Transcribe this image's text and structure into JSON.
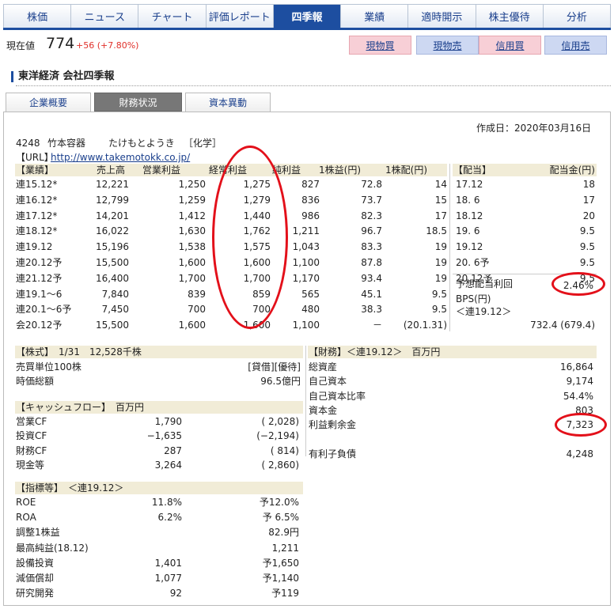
{
  "nav": {
    "tabs": [
      "株価",
      "ニュース",
      "チャート",
      "評価レポート",
      "四季報",
      "業績",
      "適時開示",
      "株主優待",
      "分析"
    ],
    "active_index": 4
  },
  "price": {
    "label": "現在値",
    "value": "774",
    "change": "+56 (+7.80%)"
  },
  "trade_buttons": [
    "現物買",
    "現物売",
    "信用買",
    "信用売"
  ],
  "section_title": "東洋経済 会社四季報",
  "subtabs": [
    "企業概要",
    "財務状況",
    "資本異動"
  ],
  "created": "作成日：2020年03月16日",
  "company": {
    "code": "4248",
    "name": "竹本容器",
    "kana": "たけもとようき",
    "industry": "［化学］",
    "url_label": "【URL】",
    "url": "http://www.takemotokk.co.jp/"
  },
  "results": {
    "headers": [
      "【業績】",
      "売上高",
      "営業利益",
      "経常利益",
      "純利益",
      "1株益(円)",
      "1株配(円)"
    ],
    "rows": [
      [
        "連15.12*",
        "12,221",
        "1,250",
        "1,275",
        "827",
        "72.8",
        "14"
      ],
      [
        "連16.12*",
        "12,799",
        "1,259",
        "1,279",
        "836",
        "73.7",
        "15"
      ],
      [
        "連17.12*",
        "14,201",
        "1,412",
        "1,440",
        "986",
        "82.3",
        "17"
      ],
      [
        "連18.12*",
        "16,022",
        "1,630",
        "1,762",
        "1,211",
        "96.7",
        "18.5"
      ],
      [
        "連19.12",
        "15,196",
        "1,538",
        "1,575",
        "1,043",
        "83.3",
        "19"
      ],
      [
        "連20.12予",
        "15,500",
        "1,600",
        "1,600",
        "1,100",
        "87.8",
        "19"
      ],
      [
        "連21.12予",
        "16,400",
        "1,700",
        "1,700",
        "1,170",
        "93.4",
        "19"
      ],
      [
        "連19.1～6",
        "7,840",
        "839",
        "859",
        "565",
        "45.1",
        "9.5"
      ],
      [
        "連20.1～6予",
        "7,450",
        "700",
        "700",
        "480",
        "38.3",
        "9.5"
      ],
      [
        "会20.12予",
        "15,500",
        "1,600",
        "1,600",
        "1,100",
        "－",
        "(20.1.31)"
      ]
    ]
  },
  "dividend": {
    "headers": [
      "【配当】",
      "配当金(円)"
    ],
    "rows": [
      [
        "17.12",
        "18"
      ],
      [
        "18. 6",
        "17"
      ],
      [
        "18.12",
        "20"
      ],
      [
        "19. 6",
        "9.5"
      ],
      [
        "19.12",
        "9.5"
      ],
      [
        "20. 6予",
        "9.5"
      ],
      [
        "20.12予",
        "9.5"
      ]
    ],
    "yield_label": "予想配当利回",
    "yield_value": "2.46%",
    "bps_label": "BPS(円)",
    "bps_basis": "＜連19.12＞",
    "bps_value": "732.4 (679.4)"
  },
  "stock": {
    "header": "【株式】　1/31　12,528千株",
    "rows": [
      [
        "売買単位100株",
        "[貸借][優待]"
      ],
      [
        "時価総額",
        "96.5億円"
      ]
    ]
  },
  "cashflow": {
    "header": "【キャッシュフロー】　百万円",
    "rows": [
      [
        "営業CF",
        "1,790",
        "( 2,028)"
      ],
      [
        "投資CF",
        "−1,635",
        "(−2,194)"
      ],
      [
        "財務CF",
        "287",
        "( 814)"
      ],
      [
        "現金等",
        "3,264",
        "( 2,860)"
      ]
    ]
  },
  "indicators": {
    "header": "【指標等】　＜連19.12＞",
    "rows": [
      [
        "ROE",
        "11.8%",
        "予12.0%"
      ],
      [
        "ROA",
        "6.2%",
        "予 6.5%"
      ],
      [
        "調整1株益",
        "",
        "82.9円"
      ],
      [
        "最高純益(18.12)",
        "",
        "1,211"
      ],
      [
        "設備投資",
        "1,401",
        "予1,650"
      ],
      [
        "減価償却",
        "1,077",
        "予1,140"
      ],
      [
        "研究開発",
        "92",
        "予119"
      ]
    ]
  },
  "finance": {
    "header": "【財務】＜連19.12＞　百万円",
    "rows": [
      [
        "総資産",
        "16,864"
      ],
      [
        "自己資本",
        "9,174"
      ],
      [
        "自己資本比率",
        "54.4%"
      ],
      [
        "資本金",
        "803"
      ],
      [
        "利益剰余金",
        "7,323"
      ],
      [
        "",
        ""
      ],
      [
        "有利子負債",
        "4,248"
      ]
    ]
  },
  "colors": {
    "nav_active": "#1d4ea0",
    "change_up": "#e0302a",
    "annotation_circle": "#e3101a",
    "header_band": "#f1ecd7"
  }
}
